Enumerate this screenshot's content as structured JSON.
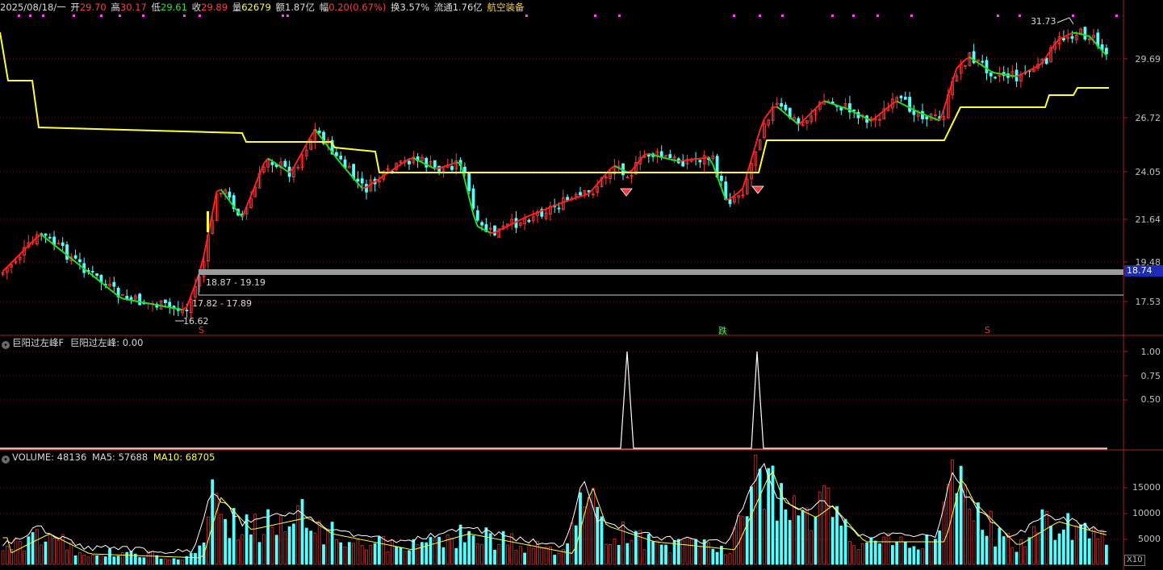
{
  "header": {
    "date": "2025/08/18/一",
    "open_label": "开",
    "open": "29.70",
    "high_label": "高",
    "high": "30.17",
    "low_label": "低",
    "low": "29.61",
    "close_label": "收",
    "close": "29.89",
    "volume_label": "量",
    "volume": "62679",
    "amount_label": "额",
    "amount": "1.87亿",
    "change_label": "幅",
    "change": "0.20(0.67%)",
    "turnover_label": "换",
    "turnover": "3.57%",
    "float_label": "流通",
    "float": "1.76亿",
    "sector": "航空装备"
  },
  "main_axis": {
    "ticks": [
      "29.69",
      "26.72",
      "24.05",
      "21.64",
      "19.48",
      "17.53"
    ]
  },
  "current_price_tag": "18.74",
  "annotations": {
    "peak": "31.73",
    "trough": "16.62",
    "zone_upper": "18.87 - 19.19",
    "zone_lower": "17.82 - 17.89"
  },
  "signals": {
    "s1": "S",
    "s2": "跌",
    "s3": "S"
  },
  "indicator_panel": {
    "title": "巨阳过左峰F",
    "value_label": "巨阳过左峰: 0.00",
    "ticks": [
      "1.00",
      "0.75",
      "0.50"
    ]
  },
  "volume_panel": {
    "title": "VOLUME: 48136",
    "ma5": "MA5: 57688",
    "ma10": "MA10: 68705",
    "ticks": [
      "15000",
      "10000",
      "5000"
    ],
    "scale": "X10"
  },
  "colors": {
    "up": "#ff3c3c",
    "down": "#54ffff",
    "ma_up": "#ff2020",
    "ma_down": "#22dd22",
    "stop_line": "#ffff33",
    "grid": "#7a1a1a",
    "axis_text": "#c0c0c0"
  }
}
